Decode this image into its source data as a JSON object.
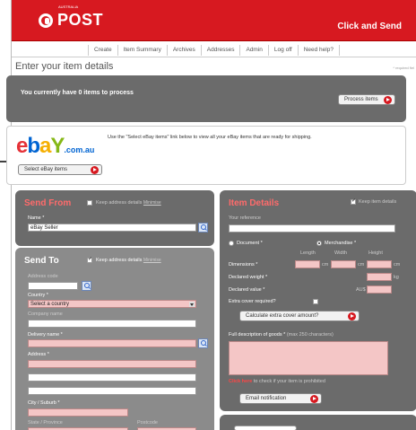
{
  "header": {
    "brand_small": "AUSTRALIA",
    "brand": "POST",
    "tagline": "Click and Send"
  },
  "nav": [
    "Create",
    "Item Summary",
    "Archives",
    "Addresses",
    "Admin",
    "Log off",
    "Need help?"
  ],
  "page": {
    "title": "Enter your item details",
    "required_note": "* required fiel"
  },
  "process": {
    "message": "You currently have 0 items to process",
    "button": "Process items"
  },
  "ebay": {
    "logo": {
      "e": "e",
      "b": "b",
      "a": "a",
      "y": "Y",
      "domain": ".com.au"
    },
    "info": "Use the \"Select eBay items\" link below to view all your eBay items that are ready for shipping.",
    "button": "Select eBay items"
  },
  "send_from": {
    "title": "Send From",
    "keep_label": "Keep address details",
    "minimise": "Minimise",
    "name_label": "Name *",
    "name_value": "eBay Seller"
  },
  "send_to": {
    "title": "Send To",
    "keep_label": "Keep address details",
    "minimise": "Minimise",
    "address_code_label": "Address code",
    "country_label": "Country *",
    "country_value": "Select a country",
    "company_label": "Company name",
    "delivery_name_label": "Delivery name *",
    "address_label": "Address *",
    "city_label": "City / Suburb *",
    "state_label": "State / Province",
    "postcode_label": "Postcode"
  },
  "item_details": {
    "title": "Item Details",
    "keep_label": "Keep item details",
    "your_reference": "Your reference",
    "document": "Document *",
    "merchandise": "Merchandise *",
    "length": "Length",
    "width": "Width",
    "height": "Height",
    "dimensions_label": "Dimensions *",
    "cm": "cm",
    "declared_weight": "Declared weight *",
    "kg": "kg",
    "declared_value": "Declared value *",
    "aud": "AU$",
    "extra_cover": "Extra cover required?",
    "calc_button": "Calculate extra cover amount?",
    "full_description": "Full description of goods *",
    "max_chars": "(max 250 characters)",
    "prohibited_link": "Click here",
    "prohibited_text": "to check if your item is prohibited",
    "email_button": "Email notification"
  },
  "colors": {
    "brand_red": "#d71920",
    "panel_grey": "#6b6b6b",
    "field_pink": "#f4c6c6"
  }
}
